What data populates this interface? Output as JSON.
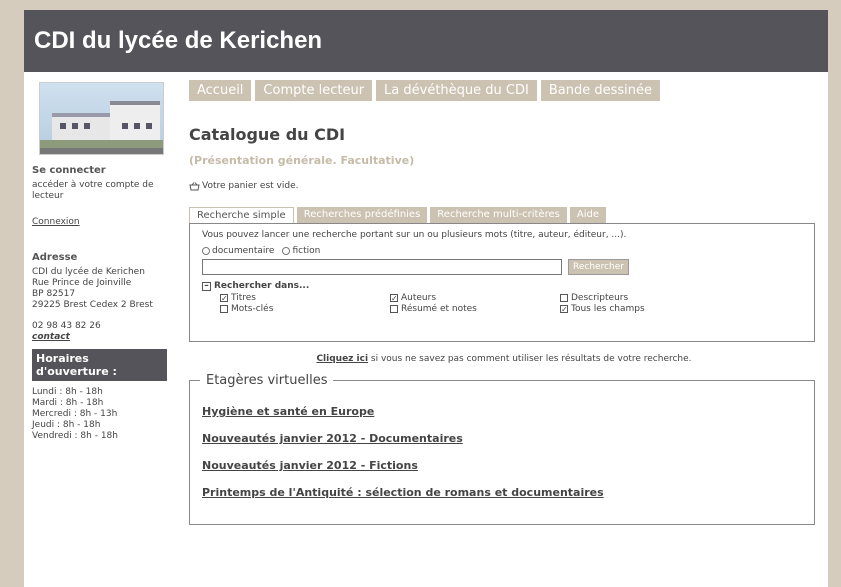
{
  "header": {
    "title": "CDI du lycée de Kerichen"
  },
  "sidebar": {
    "login_heading": "Se connecter",
    "login_text": "accéder à votre compte de lecteur",
    "login_link": "Connexion",
    "address_heading": "Adresse",
    "address_lines": [
      "CDI du lycée de Kerichen",
      "Rue Prince de Joinville",
      "BP 82517",
      "29225 Brest Cedex 2 Brest"
    ],
    "phone": "02 98 43 82 26",
    "contact_link": "contact",
    "hours_heading": "Horaires d'ouverture :",
    "hours": [
      "Lundi : 8h - 18h",
      "Mardi : 8h - 18h",
      "Mercredi : 8h - 13h",
      "Jeudi : 8h - 18h",
      "Vendredi : 8h - 18h"
    ]
  },
  "nav": [
    "Accueil",
    "Compte lecteur",
    "La dévéthèque du CDI",
    "Bande dessinée"
  ],
  "catalog": {
    "title": "Catalogue du CDI",
    "subtitle": "(Présentation générale. Facultative)",
    "basket": "Votre panier est vide."
  },
  "tabs": [
    "Recherche simple",
    "Recherches prédéfinies",
    "Recherche multi-critères",
    "Aide"
  ],
  "search": {
    "intro": "Vous pouvez lancer une recherche portant sur un ou plusieurs mots (titre, auteur, éditeur, ...).",
    "type_documentaire": "documentaire",
    "type_fiction": "fiction",
    "input_value": "",
    "button": "Rechercher",
    "search_in": "Rechercher dans...",
    "fields": [
      {
        "label": "Titres",
        "checked": true
      },
      {
        "label": "Auteurs",
        "checked": true
      },
      {
        "label": "Descripteurs",
        "checked": false
      },
      {
        "label": "Mots-clés",
        "checked": false
      },
      {
        "label": "Résumé et notes",
        "checked": false
      },
      {
        "label": "Tous les champs",
        "checked": true
      }
    ]
  },
  "help": {
    "link": "Cliquez ici",
    "text": " si vous ne savez pas comment utiliser les résultats de votre recherche."
  },
  "shelves": {
    "legend": "Etagères virtuelles",
    "items": [
      "Hygiène et santé en Europe",
      "Nouveautés janvier 2012 - Documentaires",
      "Nouveautés janvier 2012 - Fictions",
      "Printemps de l'Antiquité : sélection de romans et documentaires"
    ]
  }
}
